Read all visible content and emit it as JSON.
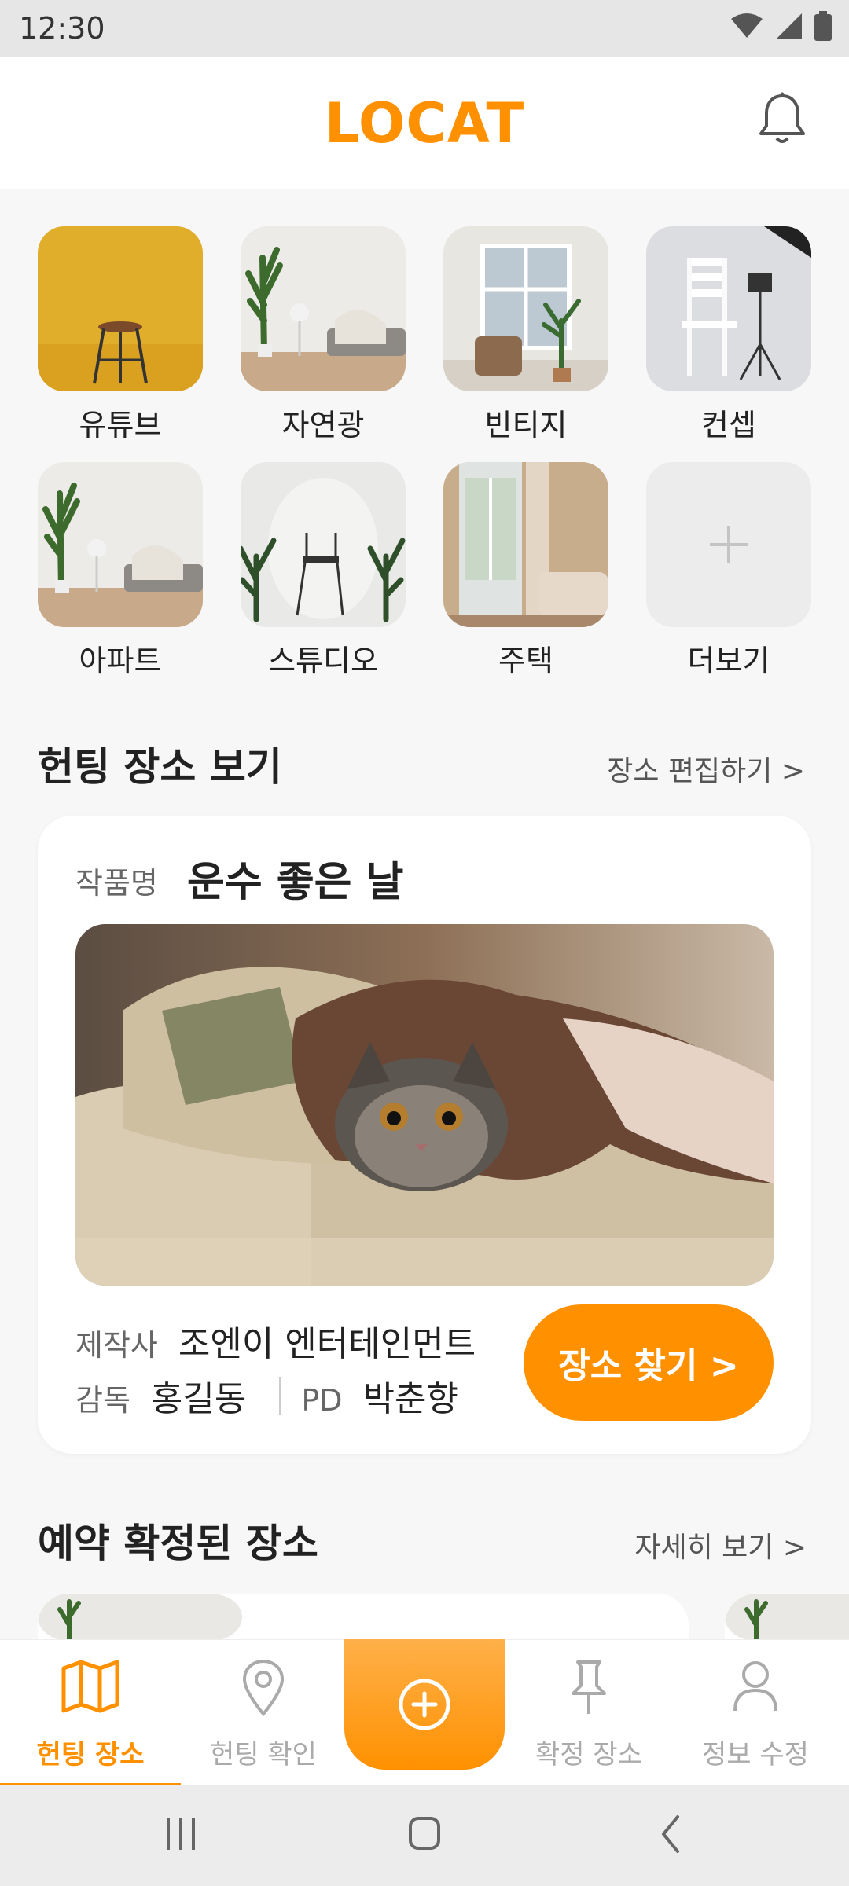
{
  "status_bar": {
    "time": "12:30",
    "icons": [
      "wifi-icon",
      "signal-icon",
      "battery-icon"
    ]
  },
  "header": {
    "logo": "LOCAT",
    "notification_icon": "bell-icon"
  },
  "categories": [
    {
      "label": "유튜브"
    },
    {
      "label": "자연광"
    },
    {
      "label": "빈티지"
    },
    {
      "label": "컨셉"
    },
    {
      "label": "아파트"
    },
    {
      "label": "스튜디오"
    },
    {
      "label": "주택"
    },
    {
      "label": "더보기"
    }
  ],
  "hunting_section": {
    "title": "헌팅 장소 보기",
    "link": "장소 편집하기 >"
  },
  "work_card": {
    "title_label": "작품명",
    "title": "운수 좋은 날",
    "producer_label": "제작사",
    "producer": "조엔이 엔터테인먼트",
    "director_label": "감독",
    "director": "홍길동",
    "pd_label": "PD",
    "pd": "박춘향",
    "button": "장소 찾기 >"
  },
  "confirmed_section": {
    "title": "예약 확정된 장소",
    "link": "자세히 보기 >"
  },
  "bottom_nav": {
    "tabs": [
      {
        "label": "헌팅 장소",
        "icon": "map-icon",
        "active": true
      },
      {
        "label": "헌팅 확인",
        "icon": "location-pin-icon",
        "active": false
      },
      {
        "label": "확정 장소",
        "icon": "pushpin-icon",
        "active": false
      },
      {
        "label": "정보 수정",
        "icon": "user-icon",
        "active": false
      }
    ],
    "center_icon": "add-circle-icon"
  },
  "colors": {
    "accent": "#ff9100",
    "inactive": "#aaaaaa"
  }
}
